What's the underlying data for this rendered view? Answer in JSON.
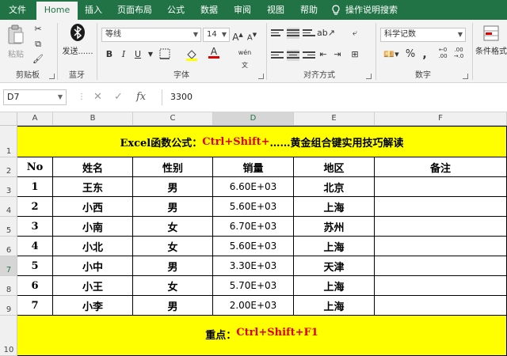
{
  "ribbon_tabs": [
    "文件",
    "Home",
    "插入",
    "页面布局",
    "公式",
    "数据",
    "审阅",
    "视图",
    "帮助",
    "操作说明搜索"
  ],
  "active_tab": "Home",
  "groups": {
    "clipboard": {
      "label": "剪贴板",
      "paste": "粘贴"
    },
    "bluetooth": {
      "label": "蓝牙",
      "send": "发送......"
    },
    "font": {
      "label": "字体",
      "font_name": "等线",
      "font_size": "14",
      "bold": "B",
      "italic": "I",
      "underline": "U"
    },
    "alignment": {
      "label": "对齐方式"
    },
    "number": {
      "label": "数字",
      "format": "科学记数",
      "percent": "%"
    },
    "styles": {
      "cond_format": "条件格式"
    }
  },
  "formula_bar": {
    "name_box": "D7",
    "fx": "fx",
    "formula": "3300"
  },
  "columns": [
    "A",
    "B",
    "C",
    "D",
    "E",
    "F"
  ],
  "rows": [
    "1",
    "2",
    "3",
    "4",
    "5",
    "6",
    "7",
    "8",
    "9",
    "10"
  ],
  "title": {
    "black1": "Excel函数公式：",
    "red": "Ctrl+Shift+",
    "black2": "……黄金组合键实用技巧解读"
  },
  "headers": [
    "No",
    "姓名",
    "性别",
    "销量",
    "地区",
    "备注"
  ],
  "table": [
    [
      "1",
      "王东",
      "男",
      "6.60E+03",
      "北京",
      ""
    ],
    [
      "2",
      "小西",
      "男",
      "5.60E+03",
      "上海",
      ""
    ],
    [
      "3",
      "小南",
      "女",
      "6.70E+03",
      "苏州",
      ""
    ],
    [
      "4",
      "小北",
      "女",
      "5.60E+03",
      "上海",
      ""
    ],
    [
      "5",
      "小中",
      "男",
      "3.30E+03",
      "天津",
      ""
    ],
    [
      "6",
      "小王",
      "女",
      "5.70E+03",
      "上海",
      ""
    ],
    [
      "7",
      "小李",
      "男",
      "2.00E+03",
      "上海",
      ""
    ]
  ],
  "footer": {
    "black": "重点：",
    "red": "Ctrl+Shift+F1"
  },
  "colors": {
    "ribbon_green": "#217346",
    "highlight_yellow": "#ffff00",
    "accent_red": "#e00000"
  }
}
